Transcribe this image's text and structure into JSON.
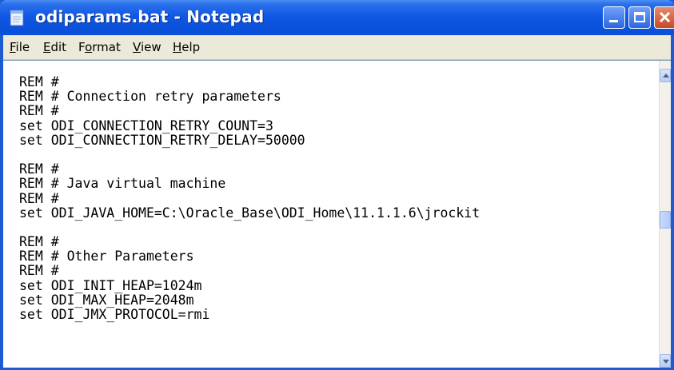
{
  "window": {
    "title": "odiparams.bat - Notepad"
  },
  "menu": {
    "file": {
      "first": "F",
      "rest": "ile"
    },
    "edit": {
      "first": "E",
      "rest": "dit"
    },
    "format": {
      "pre": "F",
      "ul": "o",
      "post": "rmat"
    },
    "view": {
      "first": "V",
      "rest": "iew"
    },
    "help": {
      "first": "H",
      "rest": "elp"
    }
  },
  "editor": {
    "lines": [
      "REM #",
      "REM # Connection retry parameters",
      "REM #",
      "set ODI_CONNECTION_RETRY_COUNT=3",
      "set ODI_CONNECTION_RETRY_DELAY=50000",
      "",
      "REM #",
      "REM # Java virtual machine",
      "REM #",
      "set ODI_JAVA_HOME=C:\\Oracle_Base\\ODI_Home\\11.1.1.6\\jrockit",
      "",
      "REM #",
      "REM # Other Parameters",
      "REM #",
      "set ODI_INIT_HEAP=1024m",
      "set ODI_MAX_HEAP=2048m",
      "set ODI_JMX_PROTOCOL=rmi"
    ]
  },
  "icons": {
    "app": "notepad-icon",
    "minimize": "minimize-icon",
    "maximize": "maximize-icon",
    "close": "close-icon"
  },
  "colors": {
    "titlebar": "#0a54dc",
    "close": "#d25a33",
    "menubar": "#ece9d8"
  }
}
